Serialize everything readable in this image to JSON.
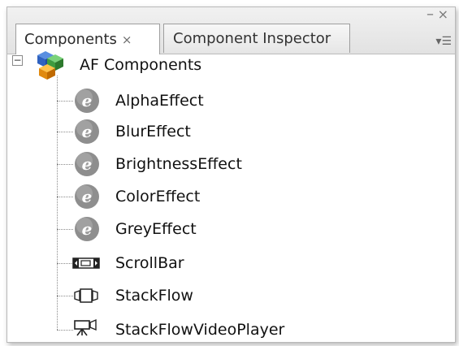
{
  "tabs": [
    {
      "label": "Components",
      "close": "×",
      "active": true
    },
    {
      "label": "Component Inspector",
      "active": false
    }
  ],
  "panel_controls": {
    "minimize": "–",
    "close": "×",
    "menu": "▾☰"
  },
  "tree": {
    "root": {
      "label": "AF Components",
      "expander": "−",
      "icon": "cubes-icon"
    },
    "items": [
      {
        "label": "AlphaEffect",
        "icon": "effect-icon"
      },
      {
        "label": "BlurEffect",
        "icon": "effect-icon"
      },
      {
        "label": "BrightnessEffect",
        "icon": "effect-icon"
      },
      {
        "label": "ColorEffect",
        "icon": "effect-icon"
      },
      {
        "label": "GreyEffect",
        "icon": "effect-icon"
      },
      {
        "label": "ScrollBar",
        "icon": "scrollbar-icon"
      },
      {
        "label": "StackFlow",
        "icon": "stackflow-icon"
      },
      {
        "label": "StackFlowVideoPlayer",
        "icon": "video-player-icon"
      }
    ]
  },
  "colors": {
    "effect_icon": "#8a8a8a",
    "panel_border": "#b9b9b9"
  }
}
